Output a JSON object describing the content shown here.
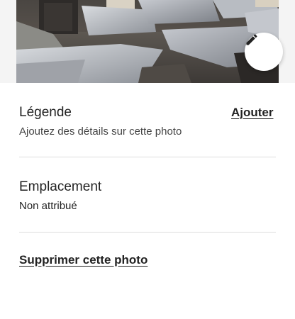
{
  "photo": {
    "description_icon": "pencil-icon"
  },
  "caption": {
    "label": "Légende",
    "hint": "Ajoutez des détails sur cette photo",
    "action_label": "Ajouter"
  },
  "location": {
    "label": "Emplacement",
    "value": "Non attribué"
  },
  "delete": {
    "label": "Supprimer cette photo"
  },
  "colors": {
    "text": "#222222",
    "divider": "#dddddd",
    "background": "#ffffff"
  }
}
